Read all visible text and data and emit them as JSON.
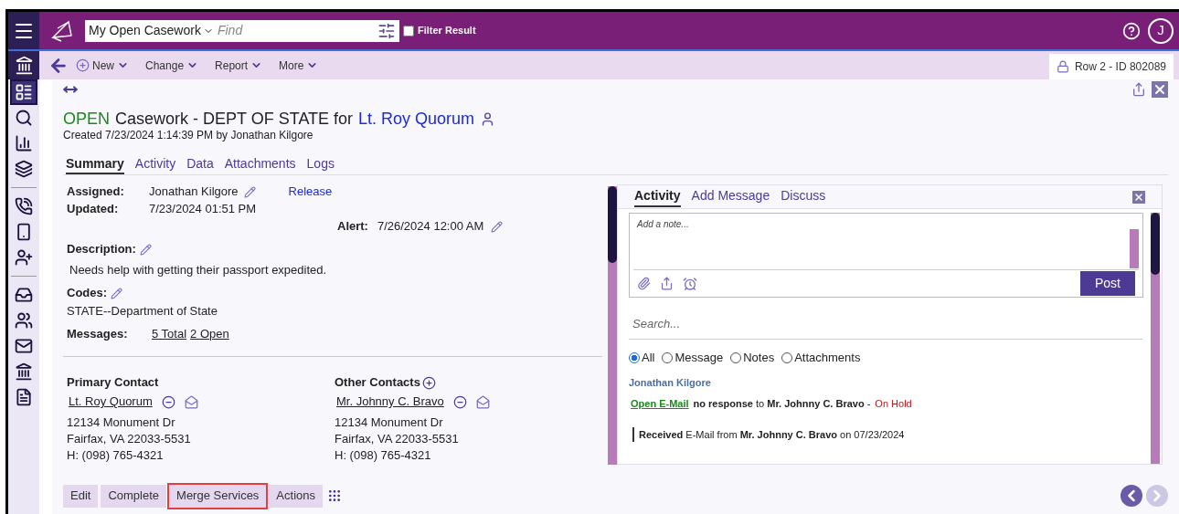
{
  "topbar": {
    "view_selector": "My Open Casework",
    "search_placeholder": "Find",
    "filter_result": {
      "label": "Filter Result",
      "checked": false
    },
    "avatar_initial": "J"
  },
  "sidebar": {
    "groups": [
      [
        {
          "kind": "layout",
          "selected": true
        },
        {
          "kind": "search",
          "selected": false
        },
        {
          "kind": "chart",
          "selected": false
        },
        {
          "kind": "layers",
          "selected": false
        }
      ],
      [
        {
          "kind": "phone",
          "selected": false
        },
        {
          "kind": "mobile",
          "selected": false
        },
        {
          "kind": "user-plus",
          "selected": false
        }
      ],
      [
        {
          "kind": "inbox",
          "selected": false
        },
        {
          "kind": "users",
          "selected": false
        },
        {
          "kind": "mail",
          "selected": false
        },
        {
          "kind": "bank",
          "selected": false
        },
        {
          "kind": "document",
          "selected": false
        }
      ]
    ]
  },
  "toolbar": {
    "items": [
      "New",
      "Change",
      "Report",
      "More"
    ],
    "record_tag": "Row 2 - ID 802089"
  },
  "header": {
    "status": "OPEN",
    "title": "Casework - DEPT OF STATE for",
    "contact": "Lt. Roy Quorum",
    "created": "Created 7/23/2024 1:14:39 PM by Jonathan Kilgore"
  },
  "tabs": [
    {
      "label": "Summary",
      "selected": true
    },
    {
      "label": "Activity",
      "selected": false
    },
    {
      "label": "Data",
      "selected": false
    },
    {
      "label": "Attachments",
      "selected": false
    },
    {
      "label": "Logs",
      "selected": false
    }
  ],
  "summary": {
    "assigned_label": "Assigned:",
    "assigned_value": "Jonathan Kilgore",
    "release": "Release",
    "updated_label": "Updated:",
    "updated_value": "7/23/2024 01:51 PM",
    "alert_label": "Alert:",
    "alert_value": "7/26/2024 12:00 AM",
    "description_label": "Description:",
    "description": "Needs help with getting their passport expedited.",
    "codes_label": "Codes:",
    "codes": "STATE--Department of State",
    "messages_label": "Messages:",
    "message_links": [
      "5 Total",
      "2 Open"
    ]
  },
  "contacts": [
    {
      "heading": "Primary Contact",
      "addable": false,
      "name": "Lt. Roy Quorum",
      "lines": [
        "12134 Monument Dr",
        "Fairfax, VA 22033-5531",
        "H: (098) 765-4321"
      ]
    },
    {
      "heading": "Other Contacts",
      "addable": true,
      "name": "Mr. Johnny C. Bravo",
      "lines": [
        "12134 Monument Dr",
        "Fairfax, VA 22033-5531",
        "H: (098) 765-4321"
      ]
    }
  ],
  "actions": [
    {
      "label": "Edit",
      "highlighted": false
    },
    {
      "label": "Complete",
      "highlighted": false
    },
    {
      "label": "Merge Services",
      "highlighted": true
    },
    {
      "label": "Actions",
      "highlighted": false
    }
  ],
  "activity_panel": {
    "tabs": [
      {
        "label": "Activity",
        "selected": true
      },
      {
        "label": "Add Message",
        "selected": false
      },
      {
        "label": "Discuss",
        "selected": false
      }
    ],
    "note_placeholder": "Add a note...",
    "post": "Post",
    "search_placeholder": "Search...",
    "filters": [
      {
        "label": "All",
        "selected": true
      },
      {
        "label": "Message",
        "selected": false
      },
      {
        "label": "Notes",
        "selected": false
      },
      {
        "label": "Attachments",
        "selected": false
      }
    ],
    "author": "Jonathan Kilgore",
    "entries": [
      {
        "kind": "link",
        "link": "Open E-Mail",
        "text": "**no response** to **Mr. Johnny C. Bravo** -",
        "status": "On Hold"
      },
      {
        "kind": "quote",
        "text": "**Received** E-Mail from **Mr. Johnny C. Bravo** on 07/23/2024"
      }
    ]
  }
}
